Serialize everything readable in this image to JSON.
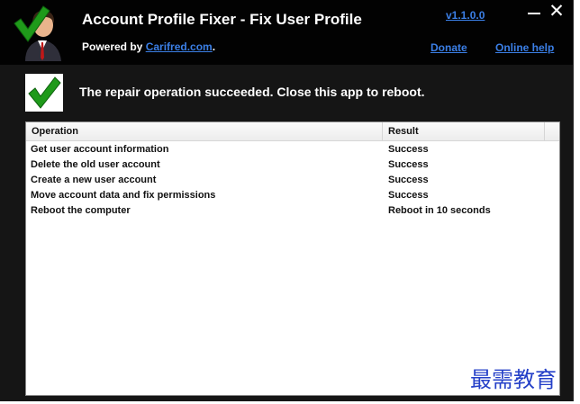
{
  "header": {
    "title": "Account Profile Fixer - Fix User Profile",
    "powered_by_prefix": "Powered by ",
    "powered_by_link": "Carifred.com",
    "powered_by_suffix": ".",
    "version": "v1.1.0.0",
    "donate": "Donate",
    "online_help": "Online help",
    "close_glyph": "✕"
  },
  "status": {
    "message": "The repair operation succeeded. Close this app to reboot."
  },
  "table": {
    "columns": {
      "operation": "Operation",
      "result": "Result"
    },
    "rows": [
      {
        "operation": "Get user account information",
        "result": "Success"
      },
      {
        "operation": "Delete the old user account",
        "result": "Success"
      },
      {
        "operation": "Create a new user account",
        "result": "Success"
      },
      {
        "operation": "Move account data and fix permissions",
        "result": "Success"
      },
      {
        "operation": "Reboot the computer",
        "result": "Reboot in 10 seconds"
      }
    ]
  },
  "watermark": "最需教育",
  "colors": {
    "link": "#3b7fe6",
    "check_green": "#1f9a1a",
    "header_bg": "#020202",
    "window_bg": "#151515",
    "watermark": "#2540c8"
  },
  "icons": {
    "logo": "user-with-checkmark-icon",
    "status": "checkmark-icon",
    "minimize": "minimize-icon",
    "close": "close-icon"
  }
}
